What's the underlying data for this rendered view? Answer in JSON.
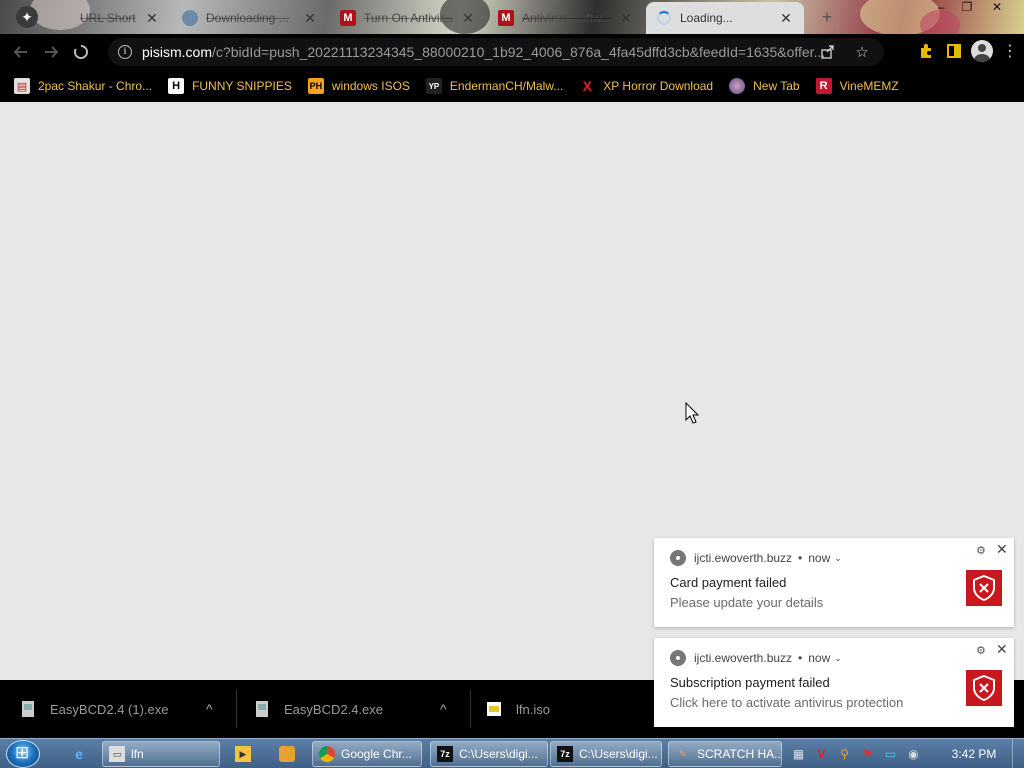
{
  "browser": {
    "tabs": [
      {
        "title": "URL Short",
        "close": "✕"
      },
      {
        "title": "Downloading ...",
        "close": "✕"
      },
      {
        "title": "Turn On Antivir...",
        "close": "✕"
      },
      {
        "title": "Antivirus Softw...",
        "close": "✕"
      },
      {
        "title": "Loading...",
        "close": "✕"
      }
    ],
    "new_tab_symbol": "+",
    "window_controls": {
      "minimize": "–",
      "restore": "❐",
      "close": "✕"
    },
    "address": {
      "host": "pisism.com",
      "path": "/c?bidId=push_20221113234345_88000210_1b92_4006_876a_4fa45dffd3cb&feedId=1635&offer..."
    },
    "bookmarks": [
      {
        "label": "2pac Shakur - Chro...",
        "icon_color": "#d9d9d9"
      },
      {
        "label": "FUNNY SNIPPIES",
        "icon": "H"
      },
      {
        "label": "windows ISOS",
        "icon": "PH"
      },
      {
        "label": "EndermanCH/Malw...",
        "icon": "YP"
      },
      {
        "label": "XP Horror Download",
        "icon": "X"
      },
      {
        "label": "New Tab"
      },
      {
        "label": "VineMEMZ",
        "icon": "R"
      }
    ]
  },
  "notifications": [
    {
      "source": "ijcti.ewoverth.buzz",
      "time": "now",
      "title": "Card payment failed",
      "body": "Please update your details"
    },
    {
      "source": "ijcti.ewoverth.buzz",
      "time": "now",
      "title": "Subscription payment failed",
      "body": "Click here to activate antivirus protection"
    }
  ],
  "downloads": [
    {
      "filename": "EasyBCD2.4 (1).exe"
    },
    {
      "filename": "EasyBCD2.4.exe"
    },
    {
      "filename": "lfn.iso"
    }
  ],
  "taskbar": {
    "buttons": [
      {
        "label": "lfn"
      },
      {
        "label": "Google Chr..."
      },
      {
        "label": "C:\\Users\\digi..."
      },
      {
        "label": "C:\\Users\\digi..."
      },
      {
        "label": "SCRATCH HA..."
      }
    ],
    "clock": "3:42 PM"
  },
  "colors": {
    "accent_red": "#c8171e",
    "bookmark_text": "#f0c050"
  }
}
